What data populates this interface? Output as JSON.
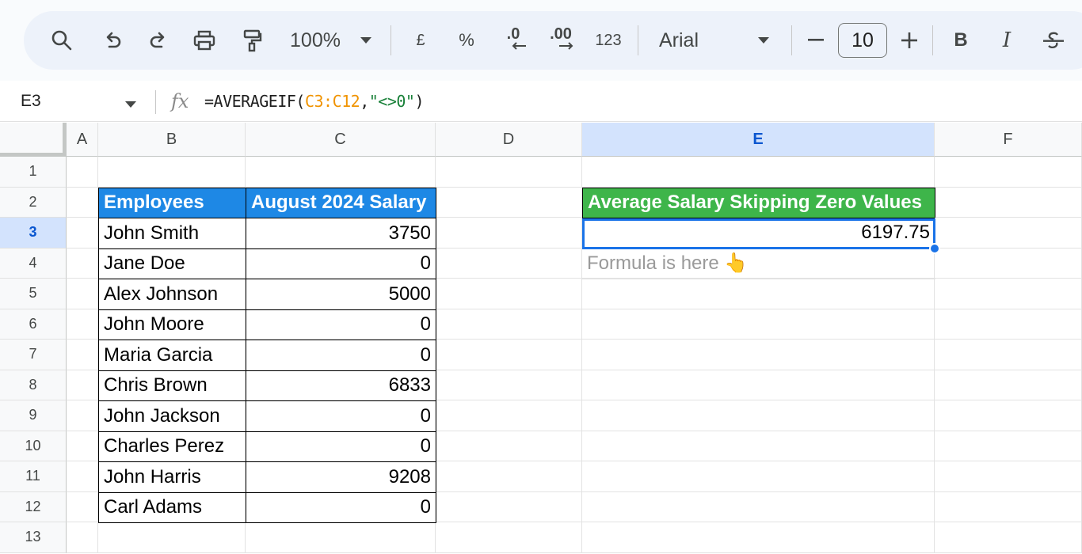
{
  "toolbar": {
    "zoom": "100%",
    "currency": "£",
    "percent": "%",
    "decrease_decimal": ".0",
    "increase_decimal": ".00",
    "number_format": "123",
    "font_name": "Arial",
    "font_size": "10",
    "bold": "B",
    "italic": "I"
  },
  "formula_bar": {
    "cell_ref": "E3",
    "fx": "fx",
    "formula_prefix": "=AVERAGEIF(",
    "formula_range": "C3:C12",
    "formula_comma": ",",
    "formula_criteria": "\"<>0\"",
    "formula_suffix": ")"
  },
  "columns": [
    "A",
    "B",
    "C",
    "D",
    "E",
    "F"
  ],
  "rows": [
    "1",
    "2",
    "3",
    "4",
    "5",
    "6",
    "7",
    "8",
    "9",
    "10",
    "11",
    "12",
    "13"
  ],
  "table": {
    "headers": [
      "Employees",
      "August 2024 Salary"
    ],
    "rows": [
      {
        "name": "John Smith",
        "salary": "3750"
      },
      {
        "name": "Jane Doe",
        "salary": "0"
      },
      {
        "name": "Alex Johnson",
        "salary": "5000"
      },
      {
        "name": "John Moore",
        "salary": "0"
      },
      {
        "name": "Maria Garcia",
        "salary": "0"
      },
      {
        "name": "Chris Brown",
        "salary": "6833"
      },
      {
        "name": "John Jackson",
        "salary": "0"
      },
      {
        "name": "Charles Perez",
        "salary": "0"
      },
      {
        "name": "John Harris",
        "salary": "9208"
      },
      {
        "name": "Carl Adams",
        "salary": "0"
      }
    ]
  },
  "result": {
    "header": "Average Salary Skipping Zero Values",
    "value": "6197.75",
    "note": "Formula is here 👆"
  },
  "colors": {
    "table_header": "#1e88e5",
    "result_header": "#3eb54a",
    "selection": "#1a73e8"
  },
  "icons": [
    "search-icon",
    "undo-icon",
    "redo-icon",
    "print-icon",
    "paint-format-icon",
    "dropdown-icon",
    "minus-icon",
    "plus-icon",
    "strikethrough-icon",
    "decrease-decimal-arrow-icon",
    "increase-decimal-arrow-icon"
  ]
}
